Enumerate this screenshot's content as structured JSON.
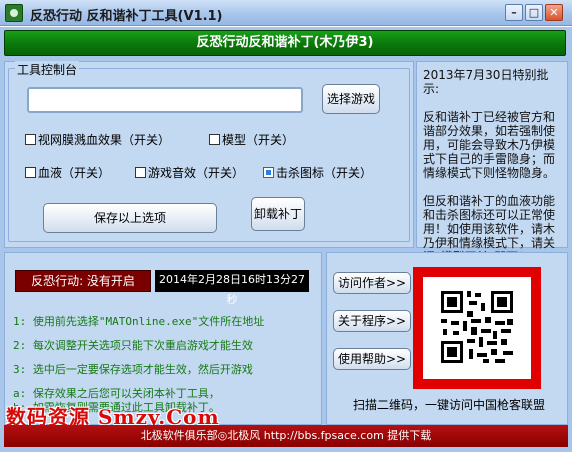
{
  "window": {
    "title": "反恐行动 反和谐补丁工具(V1.1)",
    "minimize_glyph": "–",
    "maximize_glyph": "□",
    "close_glyph": "✕"
  },
  "banner": {
    "text": "反恐行动反和谐补丁(木乃伊3)"
  },
  "tool_panel": {
    "legend": "工具控制台",
    "game_path_value": "",
    "select_game_label": "选择游戏",
    "options": [
      {
        "label": "视网膜溅血效果（开关）",
        "checked": false
      },
      {
        "label": "模型（开关）",
        "checked": false
      },
      {
        "label": "血液（开关）",
        "checked": false
      },
      {
        "label": "游戏音效（开关）",
        "checked": false
      },
      {
        "label": "击杀图标（开关）",
        "checked": true
      }
    ],
    "save_label": "保存以上选项",
    "uninstall_label": "卸载补丁"
  },
  "notice": {
    "heading": "2013年7月30日特别批示:",
    "para1": "反和谐补丁已经被官方和谐部分效果，如若强制使用，可能会导致木乃伊模式下自己的手雷隐身；而情缘模式下则怪物隐身。",
    "para2": "但反和谐补丁的血液功能和击杀图标还可以正常使用！如使用该软件，请木乃伊和情缘模式下，请关闭\"模型开关\"即可！"
  },
  "status": {
    "state_text": "反恐行动: 没有开启",
    "datetime": "2014年2月28日16时13分27秒",
    "lines": [
      "1: 使用前先选择\"MATOnline.exe\"文件所在地址",
      "2: 每次调整开关选项只能下次重启游戏才能生效",
      "3: 选中后一定要保存选项才能生效，然后开游戏",
      "a: 保存效果之后您可以关闭本补丁工具，",
      "b: 如需恢复则需要通过此工具卸载补丁。"
    ]
  },
  "links": {
    "visit_author": "访问作者>>",
    "about_program": "关于程序>>",
    "help": "使用帮助>>",
    "qr_caption": "扫描二维码，一键访问中国枪客联盟"
  },
  "watermark": {
    "text": "数码资源 Smzy.Com"
  },
  "footer": {
    "text": "北极软件俱乐部◎北极风   http://bbs.fpsace.com  提供下载"
  },
  "colors": {
    "banner_green": "#0c7a0c",
    "status_red": "#7a0000",
    "info_green": "#157a15",
    "footer_red": "#880000",
    "qr_border": "#e00000"
  }
}
